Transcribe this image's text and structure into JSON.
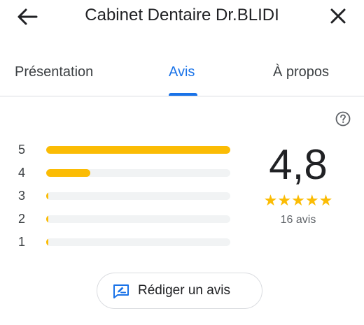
{
  "header": {
    "title": "Cabinet Dentaire Dr.BLIDI",
    "back_icon": "arrow-left-icon",
    "close_icon": "close-icon"
  },
  "tabs": [
    {
      "label": "Présentation",
      "selected": false
    },
    {
      "label": "Avis",
      "selected": true
    },
    {
      "label": "À propos",
      "selected": false
    }
  ],
  "colors": {
    "accent": "#1a73e8",
    "star": "#fbbc04",
    "track": "#f1f3f4"
  },
  "rating": {
    "score": "4,8",
    "stars_filled": 5,
    "count_text": "16 avis",
    "distribution": [
      {
        "stars": "5",
        "fraction": 1.0
      },
      {
        "stars": "4",
        "fraction": 0.24
      },
      {
        "stars": "3",
        "fraction": 0.0
      },
      {
        "stars": "2",
        "fraction": 0.0
      },
      {
        "stars": "1",
        "fraction": 0.0
      }
    ]
  },
  "actions": {
    "write_review_label": "Rédiger un avis",
    "write_review_icon": "rate-review-icon",
    "help_icon": "help-icon"
  }
}
